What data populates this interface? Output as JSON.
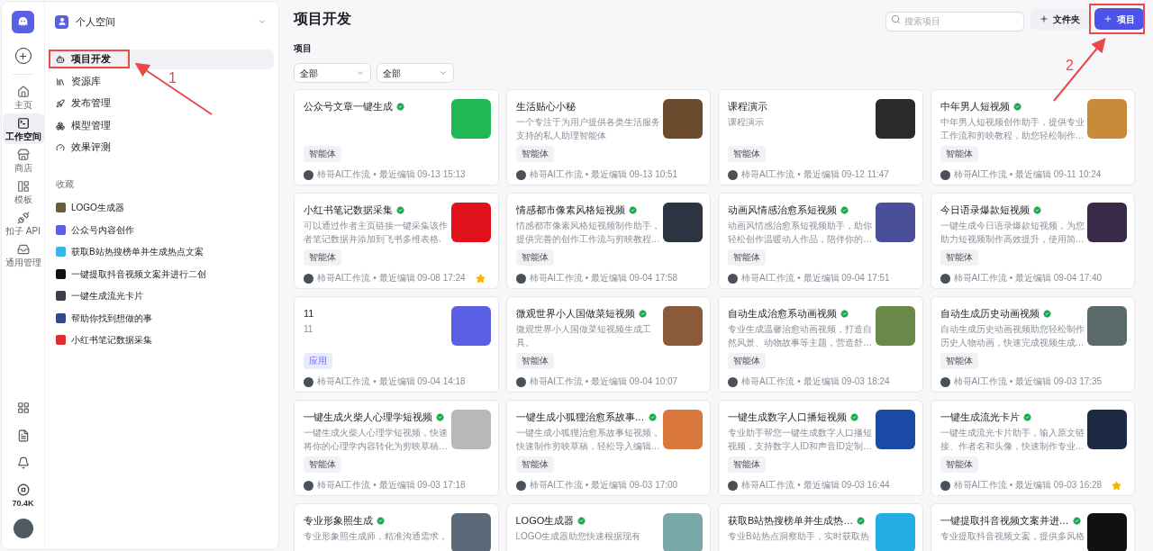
{
  "rail": {
    "items": [
      {
        "label": "主页",
        "kind": "home",
        "selected": false
      },
      {
        "label": "工作空间",
        "kind": "terminal",
        "selected": true
      },
      {
        "label": "商店",
        "kind": "store",
        "selected": false
      },
      {
        "label": "模板",
        "kind": "layout",
        "selected": false
      },
      {
        "label": "扣子 API",
        "kind": "plug",
        "selected": false
      },
      {
        "label": "通用管理",
        "kind": "inbox",
        "selected": false
      }
    ],
    "credits": "70.4K"
  },
  "sidebar": {
    "workspace": "个人空间",
    "items": [
      {
        "label": "项目开发",
        "kind": "bot",
        "selected": true
      },
      {
        "label": "资源库",
        "kind": "library",
        "selected": false
      },
      {
        "label": "发布管理",
        "kind": "rocket",
        "selected": false
      },
      {
        "label": "模型管理",
        "kind": "model",
        "selected": false
      },
      {
        "label": "效果评测",
        "kind": "gauge",
        "selected": false
      }
    ],
    "favorites_title": "收藏",
    "favorites": [
      {
        "label": "LOGO生成器",
        "color": "#6b5b3e"
      },
      {
        "label": "公众号内容创作",
        "color": "#5b5fe6"
      },
      {
        "label": "获取B站热搜榜单并生成热点文案",
        "color": "#3bb4e8"
      },
      {
        "label": "一键提取抖音视频文案并进行二创",
        "color": "#111111"
      },
      {
        "label": "一键生成流光卡片",
        "color": "#3a3f4a"
      },
      {
        "label": "帮助你找到想做的事",
        "color": "#2f4a8a"
      },
      {
        "label": "小红书笔记数据采集",
        "color": "#e02c2c"
      }
    ]
  },
  "header": {
    "title": "项目开发",
    "search": {
      "placeholder": "搜索项目"
    },
    "buttons": [
      {
        "label": "文件夹",
        "primary": false
      },
      {
        "label": "项目",
        "primary": true
      }
    ]
  },
  "section": "项目",
  "filters": [
    "全部",
    "全部"
  ],
  "cards": [
    {
      "title": "公众号文章一键生成",
      "verified": true,
      "tag": {
        "label": "智能体",
        "kind": "agent"
      },
      "meta": "柿哥AI工作流 • 最近编辑 09-13 15:13",
      "starred": false,
      "color": "#1fb855"
    },
    {
      "title": "生活贴心小秘",
      "verified": false,
      "desc": "一个专注于为用户提供各类生活服务支持的私人助理智能体",
      "tag": {
        "label": "智能体",
        "kind": "agent"
      },
      "meta": "柿哥AI工作流 • 最近编辑 09-13 10:51",
      "starred": false,
      "color": "#6b4a2e"
    },
    {
      "title": "课程演示",
      "verified": false,
      "desc": "课程演示",
      "tag": {
        "label": "智能体",
        "kind": "agent"
      },
      "meta": "柿哥AI工作流 • 最近编辑 09-12 11:47",
      "starred": false,
      "color": "#2a2a2a"
    },
    {
      "title": "中年男人短视频",
      "verified": true,
      "desc": "中年男人短视频创作助手，提供专业工作流和剪映教程，助您轻松制作…",
      "tag": {
        "label": "智能体",
        "kind": "agent"
      },
      "meta": "柿哥AI工作流 • 最近编辑 09-11 10:24",
      "starred": false,
      "color": "#c98a3a"
    },
    {
      "title": "小红书笔记数据采集",
      "verified": true,
      "desc": "可以通过作者主页链接一键采集该作者笔记数据并添加到飞书多维表格.",
      "tag": {
        "label": "智能体",
        "kind": "agent"
      },
      "meta": "柿哥AI工作流 • 最近编辑 09-08 17:24",
      "starred": true,
      "color": "#e0111b"
    },
    {
      "title": "情感都市像素风格短视频",
      "verified": true,
      "desc": "情感都市像素风格短视频制作助手，提供完善的创作工作流与剪映教程…",
      "tag": {
        "label": "智能体",
        "kind": "agent"
      },
      "meta": "柿哥AI工作流 • 最近编辑 09-04 17:58",
      "starred": false,
      "color": "#2b3440"
    },
    {
      "title": "动画风情感治愈系短视频",
      "verified": true,
      "desc": "动画风情感治愈系短视频助手，助你轻松创作温暖动人作品，陪伴你的…",
      "tag": {
        "label": "智能体",
        "kind": "agent"
      },
      "meta": "柿哥AI工作流 • 最近编辑 09-04 17:51",
      "starred": false,
      "color": "#4a4f9a"
    },
    {
      "title": "今日语录爆款短视频",
      "verified": true,
      "desc": "一键生成今日语录爆款短视频，为您助力短视频制作高效提升，使用简…",
      "tag": {
        "label": "智能体",
        "kind": "agent"
      },
      "meta": "柿哥AI工作流 • 最近编辑 09-04 17:40",
      "starred": false,
      "color": "#3a2a4a"
    },
    {
      "title": "11",
      "verified": false,
      "desc": "11",
      "tag": {
        "label": "应用",
        "kind": "app"
      },
      "meta": "柿哥AI工作流 • 最近编辑 09-04 14:18",
      "starred": false,
      "color": "#5b5fe6"
    },
    {
      "title": "微观世界小人国做菜短视频",
      "verified": true,
      "desc": "微观世界小人国做菜短视频生成工具。",
      "tag": {
        "label": "智能体",
        "kind": "agent"
      },
      "meta": "柿哥AI工作流 • 最近编辑 09-04 10:07",
      "starred": false,
      "color": "#8a5a3a"
    },
    {
      "title": "自动生成治愈系动画视频",
      "verified": true,
      "desc": "专业生成温馨治愈动画视频，打造自然风景、动物故事等主题，营造舒…",
      "tag": {
        "label": "智能体",
        "kind": "agent"
      },
      "meta": "柿哥AI工作流 • 最近编辑 09-03 18:24",
      "starred": false,
      "color": "#6a8a4a"
    },
    {
      "title": "自动生成历史动画视频",
      "verified": true,
      "desc": "自动生成历史动画视频助您轻松制作历史人物动画，快速完成视频生成…",
      "tag": {
        "label": "智能体",
        "kind": "agent"
      },
      "meta": "柿哥AI工作流 • 最近编辑 09-03 17:35",
      "starred": false,
      "color": "#5a6a6a"
    },
    {
      "title": "一键生成火柴人心理学短视频",
      "verified": true,
      "desc": "一键生成火柴人心理学短视频，快速将你的心理学内容转化为剪映草稿…",
      "tag": {
        "label": "智能体",
        "kind": "agent"
      },
      "meta": "柿哥AI工作流 • 最近编辑 09-03 17:18",
      "starred": false,
      "color": "#b8b8b8"
    },
    {
      "title": "一键生成小狐狸治愈系故事…",
      "verified": true,
      "desc": "一键生成小狐狸治愈系故事短视频，快速制作剪映草稿，轻松导入编辑…",
      "tag": {
        "label": "智能体",
        "kind": "agent"
      },
      "meta": "柿哥AI工作流 • 最近编辑 09-03 17:00",
      "starred": false,
      "color": "#d9783a"
    },
    {
      "title": "一键生成数字人口播短视频",
      "verified": true,
      "desc": "专业助手帮您一键生成数字人口播短视频，支持数字人ID和声音ID定制…",
      "tag": {
        "label": "智能体",
        "kind": "agent"
      },
      "meta": "柿哥AI工作流 • 最近编辑 09-03 16:44",
      "starred": false,
      "color": "#1a4aa8"
    },
    {
      "title": "一键生成流光卡片",
      "verified": true,
      "desc": "一键生成流光卡片助手，输入原文链接、作者名和头像，快速制作专业…",
      "tag": {
        "label": "智能体",
        "kind": "agent"
      },
      "meta": "柿哥AI工作流 • 最近编辑 09-03 16:28",
      "starred": true,
      "color": "#1e2a44"
    },
    {
      "title": "专业形象照生成",
      "verified": true,
      "desc": "专业形象照生成师，精准沟通需求，",
      "starred": false,
      "color": "#5a6a78"
    },
    {
      "title": "LOGO生成器",
      "verified": true,
      "desc": "LOGO生成器助您快速根据现有",
      "starred": false,
      "color": "#7aa8a8"
    },
    {
      "title": "获取B站热搜榜单并生成热…",
      "verified": true,
      "desc": "专业B站热点洞察助手，实时获取热",
      "starred": false,
      "color": "#23ade5"
    },
    {
      "title": "一键提取抖音视频文案并进…",
      "verified": true,
      "desc": "专业提取抖音视频文案，提供多风格",
      "starred": false,
      "color": "#111111"
    }
  ],
  "annotations": [
    {
      "label": "1"
    },
    {
      "label": "2"
    }
  ]
}
